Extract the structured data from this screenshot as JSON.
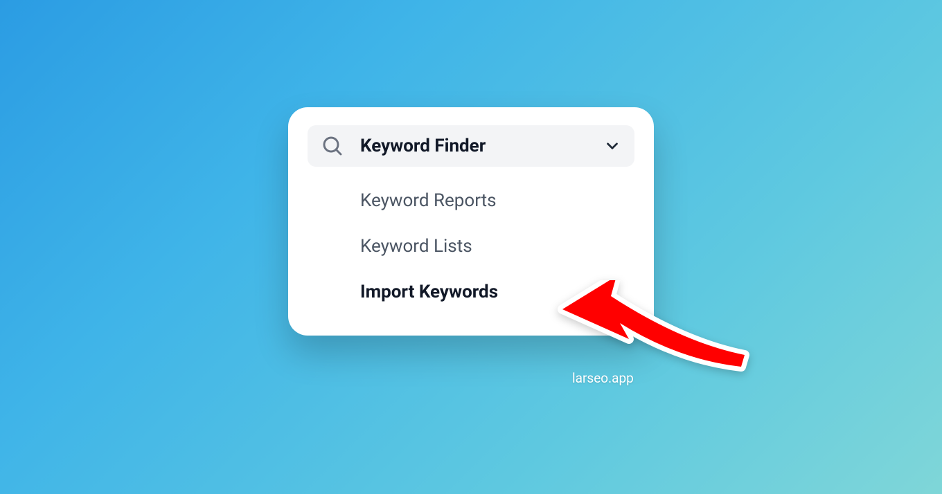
{
  "menu": {
    "header": {
      "label": "Keyword Finder"
    },
    "items": [
      {
        "label": "Keyword Reports",
        "active": false
      },
      {
        "label": "Keyword Lists",
        "active": false
      },
      {
        "label": "Import Keywords",
        "active": true
      }
    ]
  },
  "caption": "larseo.app"
}
